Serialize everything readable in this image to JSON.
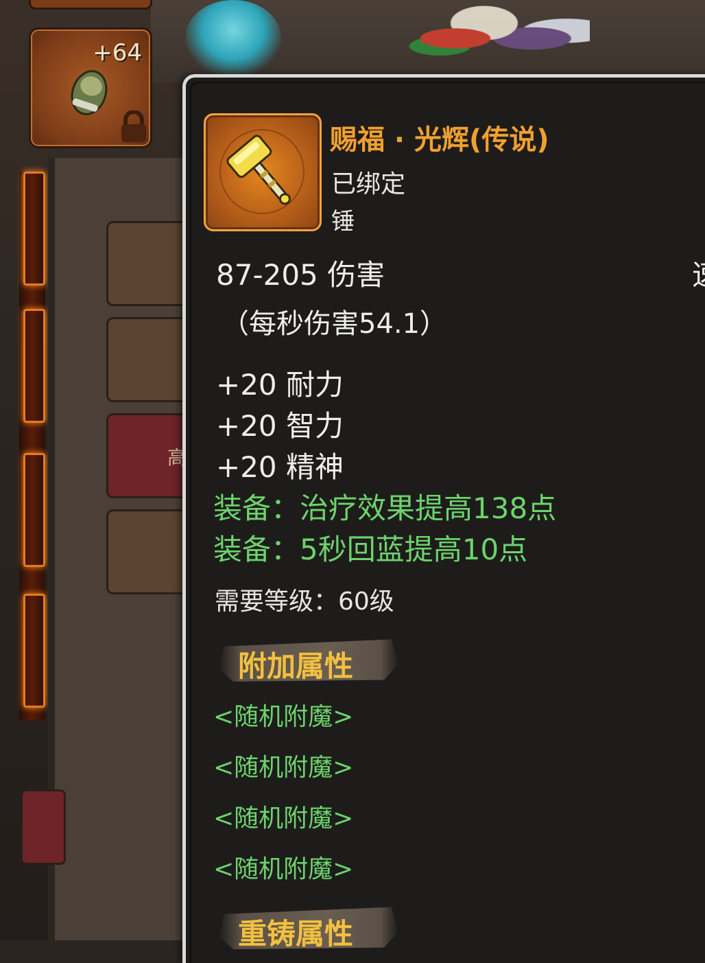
{
  "inventory": {
    "slot_count": "+64"
  },
  "side_panel": {
    "button_text": "高"
  },
  "tooltip": {
    "name": "赐福 · 光辉(传说)",
    "bound_status": "已绑定",
    "item_type": "锤",
    "damage": "87-205 伤害",
    "speed_label_cut": "速",
    "dps": "（每秒伤害54.1）",
    "stats": [
      "+20 耐力",
      "+20 智力",
      "+20 精神"
    ],
    "equip_effects": [
      "装备：治疗效果提高138点",
      "装备：5秒回蓝提高10点"
    ],
    "required_level": "需要等级：60级",
    "extra_section_title": "附加属性",
    "enchants": [
      "<随机附魔>",
      "<随机附魔>",
      "<随机附魔>",
      "<随机附魔>"
    ],
    "reforge_section_title": "重铸属性"
  },
  "colors": {
    "legendary_name": "#f0a030",
    "equip_green": "#6cd46c",
    "section_gold": "#f2c040",
    "tooltip_bg": "#1e1c1b"
  }
}
